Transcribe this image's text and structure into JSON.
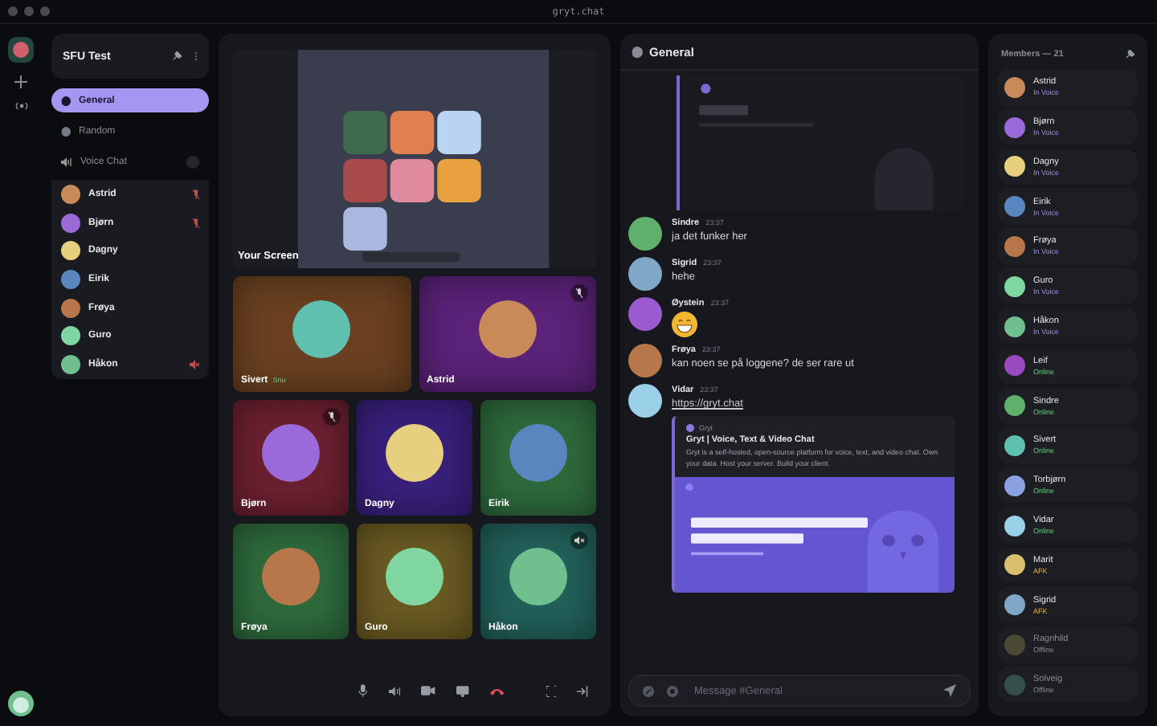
{
  "window": {
    "title": "gryt.chat"
  },
  "server": {
    "name": "SFU Test"
  },
  "channels": [
    {
      "kind": "text",
      "name": "General",
      "selected": true
    },
    {
      "kind": "text",
      "name": "Random",
      "selected": false
    },
    {
      "kind": "voice",
      "name": "Voice Chat",
      "selected": false
    }
  ],
  "voice_users": [
    {
      "name": "Astrid",
      "color": "#c98a5a",
      "muted": true,
      "deafened": false
    },
    {
      "name": "Bjørn",
      "color": "#9a6ad8",
      "muted": true,
      "deafened": false
    },
    {
      "name": "Dagny",
      "color": "#e6cf7e",
      "muted": false,
      "deafened": false
    },
    {
      "name": "Eirik",
      "color": "#5a86c0",
      "muted": false,
      "deafened": false
    },
    {
      "name": "Frøya",
      "color": "#b8774a",
      "muted": false,
      "deafened": false
    },
    {
      "name": "Guro",
      "color": "#7fd6a0",
      "muted": false,
      "deafened": false
    },
    {
      "name": "Håkon",
      "color": "#6fc08e",
      "muted": false,
      "deafened": true
    }
  ],
  "screen_share": {
    "kind": "picture",
    "label": "Your Screen"
  },
  "video_rows": [
    {
      "tiles": [
        {
          "name": "Sivert",
          "tag": "Snu",
          "color": "#6a4020",
          "avatar": {
            "color": "#5fc0b0"
          },
          "muted": false,
          "deafened": false
        },
        {
          "name": "Astrid",
          "color": "#5a2278",
          "avatar": {
            "color": "#c98a5a"
          },
          "muted": true,
          "deafened": false
        }
      ]
    },
    {
      "tiles": [
        {
          "name": "Bjørn",
          "color": "#6c2030",
          "avatar": {
            "color": "#9a6ad8"
          },
          "muted": true,
          "deafened": false
        },
        {
          "name": "Dagny",
          "color": "#38207c",
          "avatar": {
            "color": "#e6cf7e"
          },
          "muted": false,
          "deafened": false
        },
        {
          "name": "Eirik",
          "color": "#2e6a3c",
          "avatar": {
            "color": "#5a86c0"
          },
          "muted": false,
          "deafened": false
        }
      ]
    },
    {
      "tiles": [
        {
          "name": "Frøya",
          "color": "#2e6a3c",
          "avatar": {
            "color": "#b8774a"
          },
          "muted": false,
          "deafened": false
        },
        {
          "name": "Guro",
          "color": "#6a5a22",
          "avatar": {
            "color": "#7fd6a0"
          },
          "muted": false,
          "deafened": false
        },
        {
          "name": "Håkon",
          "color": "#22605a",
          "avatar": {
            "color": "#6fc08e"
          },
          "muted": false,
          "deafened": true
        }
      ]
    }
  ],
  "chat": {
    "channel": "General",
    "placeholder": "Message #General",
    "messages": [
      {
        "kind": "text",
        "author": "Sindre",
        "time": "23:37",
        "text": "ja det funker her",
        "color": "#5fb06a"
      },
      {
        "kind": "text",
        "author": "Sigrid",
        "time": "23:37",
        "text": "hehe",
        "color": "#7fa8c8"
      },
      {
        "kind": "emoji",
        "author": "Øystein",
        "time": "23:37",
        "color": "#9a5ad0"
      },
      {
        "kind": "text",
        "author": "Frøya",
        "time": "23:37",
        "text": "kan noen se på loggene? de ser rare ut",
        "color": "#b8774a"
      },
      {
        "kind": "link",
        "author": "Vidar",
        "time": "23:37",
        "text": "https://gryt.chat",
        "color": "#9ad0e8",
        "embed": {
          "site": "Gryt",
          "title": "Gryt | Voice, Text & Video Chat",
          "description": "Gryt is a self-hosted, open-source platform for voice, text, and video chat. Own your data. Host your server. Build your client."
        }
      }
    ]
  },
  "members": {
    "title": "Members — 21",
    "items": [
      {
        "name": "Astrid",
        "status": "In Voice",
        "kind": "voice",
        "color": "#c98a5a"
      },
      {
        "name": "Bjørn",
        "status": "In Voice",
        "kind": "voice",
        "color": "#9a6ad8"
      },
      {
        "name": "Dagny",
        "status": "In Voice",
        "kind": "voice",
        "color": "#e6cf7e"
      },
      {
        "name": "Eirik",
        "status": "In Voice",
        "kind": "voice",
        "color": "#5a86c0"
      },
      {
        "name": "Frøya",
        "status": "In Voice",
        "kind": "voice",
        "color": "#b8774a"
      },
      {
        "name": "Guro",
        "status": "In Voice",
        "kind": "voice",
        "color": "#7fd6a0"
      },
      {
        "name": "Håkon",
        "status": "In Voice",
        "kind": "voice",
        "color": "#6fc08e"
      },
      {
        "name": "Leif",
        "status": "Online",
        "kind": "online",
        "color": "#9a4ac0"
      },
      {
        "name": "Sindre",
        "status": "Online",
        "kind": "online",
        "color": "#5fb06a"
      },
      {
        "name": "Sivert",
        "status": "Online",
        "kind": "online",
        "color": "#5fc0b0"
      },
      {
        "name": "Torbjørn",
        "status": "Online",
        "kind": "online",
        "color": "#8aa0e0"
      },
      {
        "name": "Vidar",
        "status": "Online",
        "kind": "online",
        "color": "#9ad0e8"
      },
      {
        "name": "Marit",
        "status": "AFK",
        "kind": "afk",
        "color": "#d8c070"
      },
      {
        "name": "Sigrid",
        "status": "AFK",
        "kind": "afk",
        "color": "#7fa8c8"
      },
      {
        "name": "Ragnhild",
        "status": "Offline",
        "kind": "offline",
        "color": "#4a4a34"
      },
      {
        "name": "Solveig",
        "status": "Offline",
        "kind": "offline",
        "color": "#34504a"
      }
    ]
  }
}
